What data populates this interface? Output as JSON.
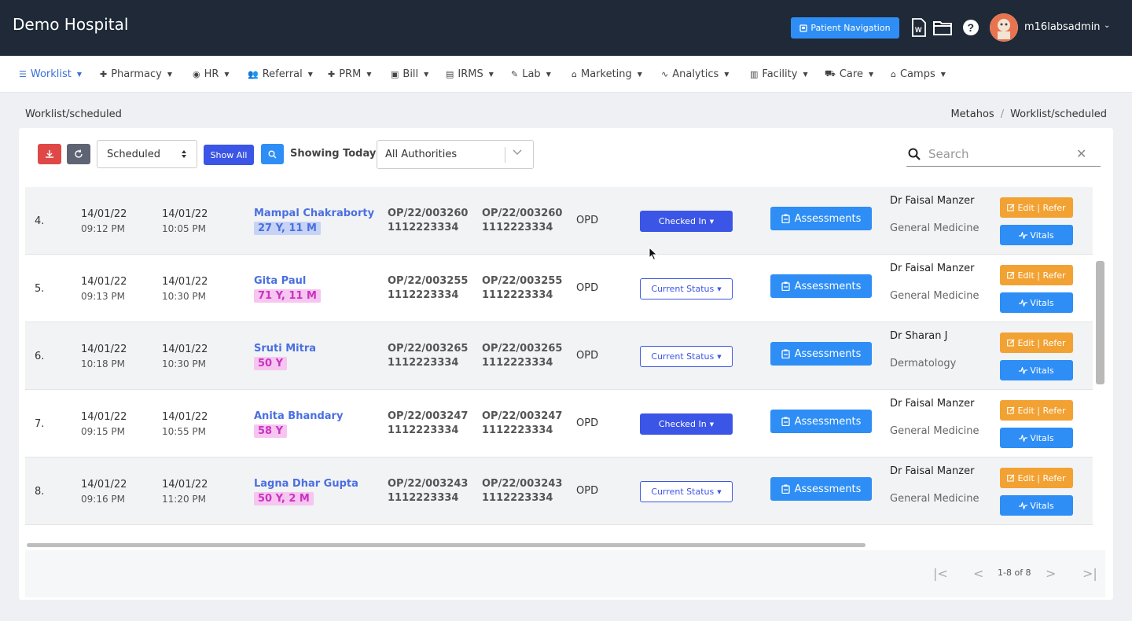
{
  "header": {
    "brand": "Demo Hospital",
    "patient_nav_label": "Patient Navigation",
    "username": "m16labsadmin"
  },
  "menu": [
    {
      "label": "Worklist",
      "icon": "list-icon",
      "glyph": "☰"
    },
    {
      "label": "Pharmacy",
      "icon": "plus-icon",
      "glyph": "✚"
    },
    {
      "label": "HR",
      "icon": "user-circle-icon",
      "glyph": "◉"
    },
    {
      "label": "Referral",
      "icon": "users-icon",
      "glyph": "👥"
    },
    {
      "label": "PRM",
      "icon": "plus-icon",
      "glyph": "✚"
    },
    {
      "label": "Bill",
      "icon": "bill-icon",
      "glyph": "▣"
    },
    {
      "label": "IRMS",
      "icon": "id-card-icon",
      "glyph": "▤"
    },
    {
      "label": "Lab",
      "icon": "flask-icon",
      "glyph": "✎"
    },
    {
      "label": "Marketing",
      "icon": "bag-icon",
      "glyph": "⌂"
    },
    {
      "label": "Analytics",
      "icon": "pulse-icon",
      "glyph": "∿"
    },
    {
      "label": "Facility",
      "icon": "building-icon",
      "glyph": "▥"
    },
    {
      "label": "Care",
      "icon": "ambulance-icon",
      "glyph": "⛟"
    },
    {
      "label": "Camps",
      "icon": "briefcase-icon",
      "glyph": "⌂"
    }
  ],
  "breadcrumb": {
    "page": "Worklist/scheduled",
    "root": "Metahos",
    "separator": "/",
    "current": "Worklist/scheduled"
  },
  "toolbar": {
    "filter_value": "Scheduled",
    "show_all_label": "Show All",
    "showing_label": "Showing Today",
    "authority_value": "All Authorities",
    "search_placeholder": "Search"
  },
  "rows": [
    {
      "index": "4.",
      "date1": "14/01/22",
      "time1": "09:12 PM",
      "date2": "14/01/22",
      "time2": "10:05 PM",
      "name": "Mampal Chakraborty",
      "age": "27 Y, 11 M",
      "age_style": "blue",
      "op1": "OP/22/003260",
      "phone1": "1112223334",
      "op2": "OP/22/003260",
      "phone2": "1112223334",
      "type": "OPD",
      "status": "Checked In",
      "status_style": "checked",
      "assess": "Assessments",
      "doctor": "Dr Faisal Manzer",
      "dept": "General Medicine",
      "edit": "Edit | Refer",
      "vitals": "Vitals"
    },
    {
      "index": "5.",
      "date1": "14/01/22",
      "time1": "09:13 PM",
      "date2": "14/01/22",
      "time2": "10:30 PM",
      "name": "Gita Paul",
      "age": "71 Y, 11 M",
      "age_style": "pink",
      "op1": "OP/22/003255",
      "phone1": "1112223334",
      "op2": "OP/22/003255",
      "phone2": "1112223334",
      "type": "OPD",
      "status": "Current Status",
      "status_style": "current",
      "assess": "Assessments",
      "doctor": "Dr Faisal Manzer",
      "dept": "General Medicine",
      "edit": "Edit | Refer",
      "vitals": "Vitals"
    },
    {
      "index": "6.",
      "date1": "14/01/22",
      "time1": "10:18 PM",
      "date2": "14/01/22",
      "time2": "10:30 PM",
      "name": "Sruti Mitra",
      "age": "50 Y",
      "age_style": "pink",
      "op1": "OP/22/003265",
      "phone1": "1112223334",
      "op2": "OP/22/003265",
      "phone2": "1112223334",
      "type": "OPD",
      "status": "Current Status",
      "status_style": "current",
      "assess": "Assessments",
      "doctor": "Dr Sharan J",
      "dept": "Dermatology",
      "edit": "Edit | Refer",
      "vitals": "Vitals"
    },
    {
      "index": "7.",
      "date1": "14/01/22",
      "time1": "09:15 PM",
      "date2": "14/01/22",
      "time2": "10:55 PM",
      "name": "Anita Bhandary",
      "age": "58 Y",
      "age_style": "pink",
      "op1": "OP/22/003247",
      "phone1": "1112223334",
      "op2": "OP/22/003247",
      "phone2": "1112223334",
      "type": "OPD",
      "status": "Checked In",
      "status_style": "checked",
      "assess": "Assessments",
      "doctor": "Dr Faisal Manzer",
      "dept": "General Medicine",
      "edit": "Edit | Refer",
      "vitals": "Vitals"
    },
    {
      "index": "8.",
      "date1": "14/01/22",
      "time1": "09:16 PM",
      "date2": "14/01/22",
      "time2": "11:20 PM",
      "name": "Lagna Dhar Gupta",
      "age": "50 Y, 2 M",
      "age_style": "pink",
      "op1": "OP/22/003243",
      "phone1": "1112223334",
      "op2": "OP/22/003243",
      "phone2": "1112223334",
      "type": "OPD",
      "status": "Current Status",
      "status_style": "current",
      "assess": "Assessments",
      "doctor": "Dr Faisal Manzer",
      "dept": "General Medicine",
      "edit": "Edit | Refer",
      "vitals": "Vitals"
    }
  ],
  "pagination": {
    "range_text": "1-8 of 8"
  },
  "colors": {
    "topbar": "#1f2937",
    "primary": "#3b55e6",
    "info": "#2e8ef5",
    "warning": "#f2a233",
    "danger": "#e04848"
  }
}
